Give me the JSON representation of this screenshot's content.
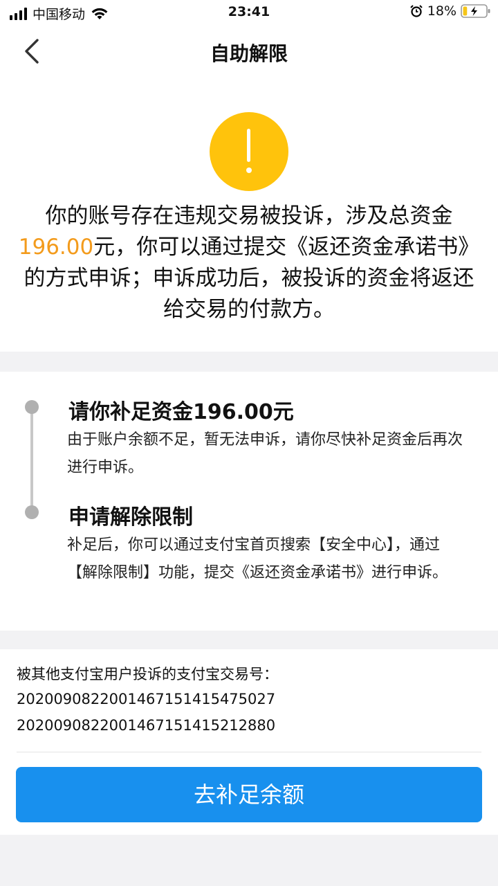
{
  "status_bar": {
    "carrier": "中国移动",
    "time": "23:41",
    "battery": "18%",
    "battery_level": 0.18,
    "icons": [
      "signal-icon",
      "wifi-icon",
      "alarm-icon",
      "battery-charging-icon"
    ]
  },
  "nav": {
    "title": "自助解限",
    "back_icon": "chevron-left-icon"
  },
  "notice": {
    "icon": "warning-icon",
    "icon_color": "#ffc30c",
    "text_before": "你的账号存在违规交易被投诉，涉及总资金",
    "amount": "196.00",
    "amount_color": "#f39b1c",
    "text_after": "元，你可以通过提交《返还资金承诺书》的方式申诉；申诉成功后，被投诉的资金将返还给交易的付款方。"
  },
  "steps": [
    {
      "title": "请你补足资金196.00元",
      "desc": "由于账户余额不足，暂无法申诉，请你尽快补足资金后再次进行申诉。"
    },
    {
      "title": "申请解除限制",
      "desc": "补足后，你可以通过支付宝首页搜索【安全中心】，通过【解除限制】功能，提交《返还资金承诺书》进行申诉。"
    }
  ],
  "complaint": {
    "label": "被其他支付宝用户投诉的支付宝交易号：",
    "trade_numbers": [
      "2020090822001467151415475027",
      "2020090822001467151415212880"
    ]
  },
  "action": {
    "button_label": "去补足余额",
    "button_color": "#1890ee"
  }
}
